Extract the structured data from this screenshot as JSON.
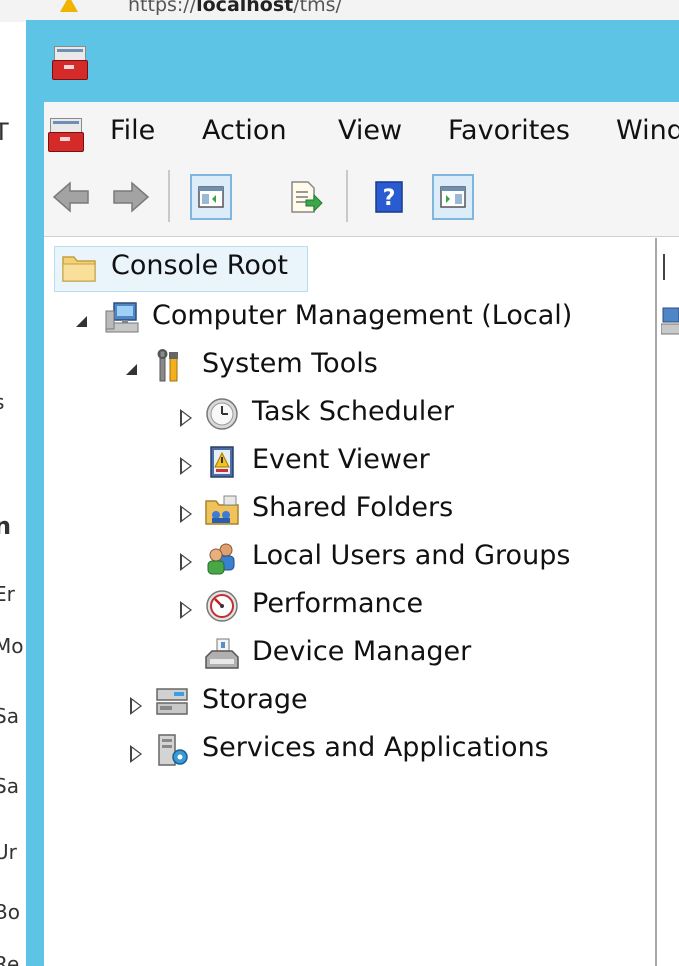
{
  "browser": {
    "url_prefix": "https://",
    "url_host": "localhost",
    "url_path": "/tms/"
  },
  "background_left_text": [
    "T",
    "s",
    "n",
    "Er",
    "Mo",
    "Sa",
    "Sa",
    "Ur",
    "Bo",
    "Re"
  ],
  "window": {
    "menu": [
      "File",
      "Action",
      "View",
      "Favorites",
      "Window"
    ]
  },
  "toolbar": {
    "buttons": [
      "back-icon",
      "forward-icon",
      "show-hide-console-tree-icon",
      "export-list-icon",
      "help-icon",
      "show-hide-action-pane-icon"
    ]
  },
  "tree": {
    "items": [
      {
        "label": "Console Root",
        "icon": "folder-icon",
        "level": 0,
        "state": "none",
        "selected": true
      },
      {
        "label": "Computer Management (Local)",
        "icon": "computer-management-icon",
        "level": 1,
        "state": "expanded"
      },
      {
        "label": "System Tools",
        "icon": "system-tools-icon",
        "level": 2,
        "state": "expanded"
      },
      {
        "label": "Task Scheduler",
        "icon": "clock-icon",
        "level": 3,
        "state": "collapsed"
      },
      {
        "label": "Event Viewer",
        "icon": "event-viewer-icon",
        "level": 3,
        "state": "collapsed"
      },
      {
        "label": "Shared Folders",
        "icon": "shared-folders-icon",
        "level": 3,
        "state": "collapsed"
      },
      {
        "label": "Local Users and Groups",
        "icon": "users-icon",
        "level": 3,
        "state": "collapsed"
      },
      {
        "label": "Performance",
        "icon": "performance-icon",
        "level": 3,
        "state": "collapsed"
      },
      {
        "label": "Device Manager",
        "icon": "device-manager-icon",
        "level": 3,
        "state": "none"
      },
      {
        "label": "Storage",
        "icon": "storage-icon",
        "level": 2,
        "state": "collapsed"
      },
      {
        "label": "Services and Applications",
        "icon": "services-icon",
        "level": 2,
        "state": "collapsed"
      }
    ]
  },
  "colors": {
    "window_frame": "#5ec4e6",
    "selection": "#eaf5fb",
    "mmc_red": "#d42a2a"
  }
}
